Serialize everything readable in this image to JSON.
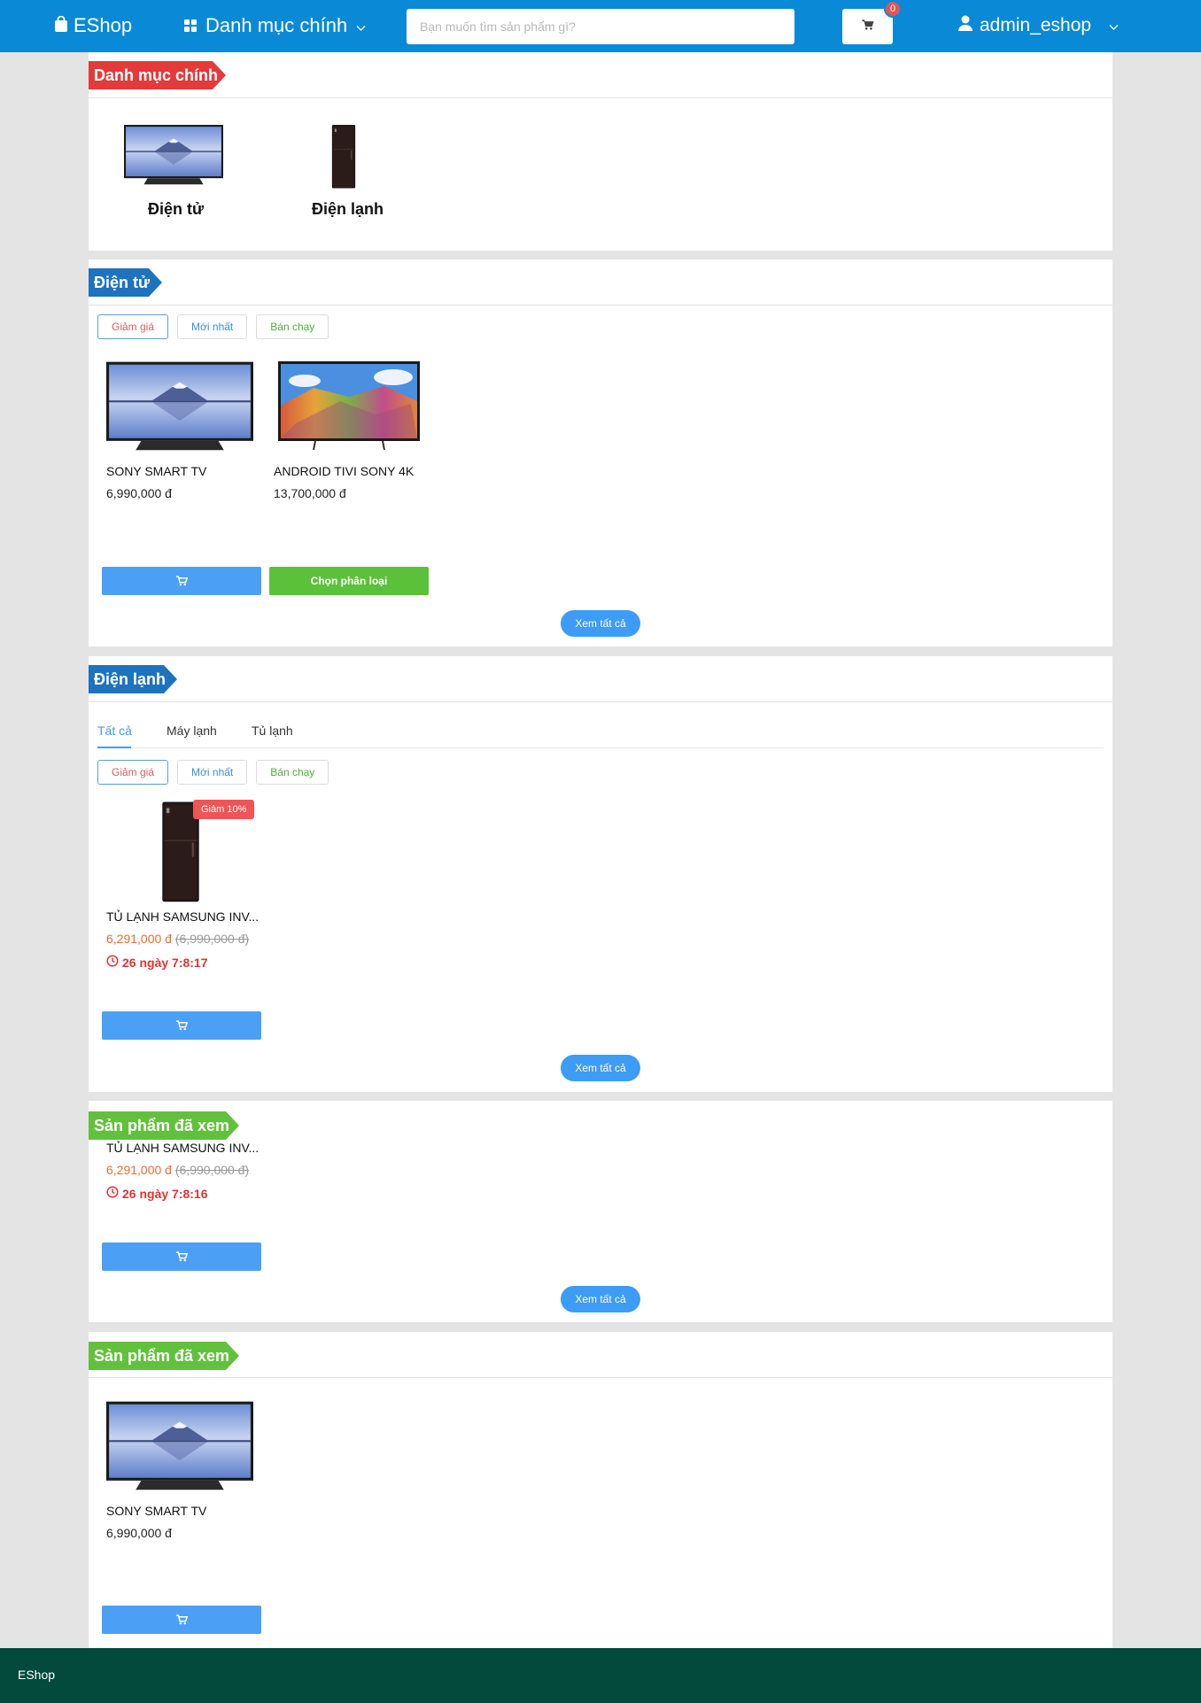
{
  "header": {
    "brand": "EShop",
    "menu_label": "Danh mục chính",
    "search_placeholder": "Bạn muốn tìm sản phẩm gì?",
    "cart_count": "0",
    "username": "admin_eshop"
  },
  "categories_section": {
    "title": "Danh mục chính",
    "items": [
      {
        "label": "Điện tử",
        "image": "tv-landscape"
      },
      {
        "label": "Điện lạnh",
        "image": "fridge"
      }
    ]
  },
  "electronics_section": {
    "title": "Điện tử",
    "filters": [
      "Giảm giá",
      "Mới nhất",
      "Bán chạy"
    ],
    "products": [
      {
        "name": "SONY SMART TV",
        "price": "6,990,000 đ"
      },
      {
        "name": "ANDROID TIVI SONY 4K",
        "price": "13,700,000 đ"
      }
    ],
    "choose_label": "Chọn phân loại",
    "view_all": "Xem tất cả"
  },
  "cooling_section": {
    "title": "Điện lạnh",
    "tabs": [
      "Tất cả",
      "Máy lạnh",
      "Tủ lạnh"
    ],
    "filters": [
      "Giảm giá",
      "Mới nhất",
      "Bán chạy"
    ],
    "product": {
      "name": "TỦ LẠNH SAMSUNG INV...",
      "sale_price": "6,291,000 đ",
      "old_price": "(6,990,000 đ)",
      "discount": "Giảm 10%",
      "countdown": "26 ngày 7:8:17"
    },
    "view_all": "Xem tất cả"
  },
  "viewed_section_1": {
    "title": "Sản phẩm đã xem",
    "product": {
      "name": "TỦ LẠNH SAMSUNG INV...",
      "sale_price": "6,291,000 đ",
      "old_price": "(6,990,000 đ)",
      "countdown": "26 ngày 7:8:16"
    },
    "view_all": "Xem tất cả"
  },
  "viewed_section_2": {
    "title": "Sản phẩm đã xem",
    "product": {
      "name": "SONY SMART TV",
      "price": "6,990,000 đ"
    }
  },
  "footer": {
    "brand": "EShop"
  },
  "colors": {
    "header": "#0a8ad6",
    "footer": "#034a3d",
    "cart_button": "#4ba0f6",
    "choose_button": "#5bc13a"
  }
}
